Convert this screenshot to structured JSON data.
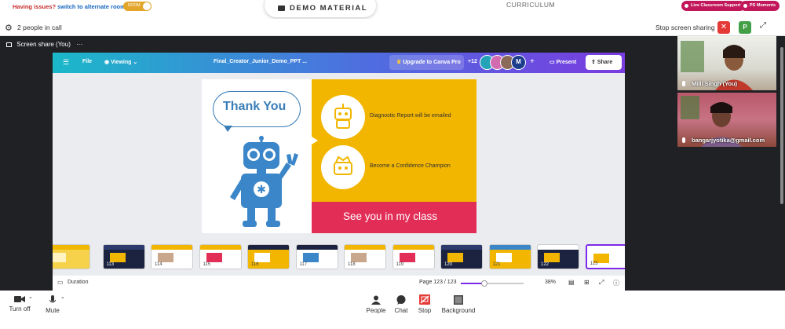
{
  "banner": {
    "issues_text": "Having issues?",
    "alternate_link": "switch to alternate room",
    "toggle_label": "ROOM",
    "demo_material": "DEMO MATERIAL",
    "curriculum": "CURRICULUM",
    "live_support": "Live Classroom Support",
    "ps_moments": "PS Moments"
  },
  "callbar": {
    "people_count": "2 people in call",
    "stop_sharing": "Stop screen sharing",
    "close_glyph": "✕",
    "p_badge": "P"
  },
  "share": {
    "label": "Screen share (You)",
    "more": "···"
  },
  "canva": {
    "file": "File",
    "viewing": "Viewing",
    "doc_title": "Final_Creator_Junior_Demo_PPT ...",
    "upgrade": "Upgrade to Canva Pro",
    "collab_count": "+12",
    "avatar_initial": "M",
    "plus": "+",
    "present": "Present",
    "share": "Share",
    "duration": "Duration",
    "page": "Page 123 / 123",
    "zoom": "38%",
    "zoom_fraction": 0.38
  },
  "slide": {
    "thank_you": "Thank You",
    "feature_1": "Diagnostic Report will be emailed",
    "feature_2": "Become a Confidence Champion",
    "cta": "See you in my class",
    "colors": {
      "yellow": "#f2b600",
      "pink": "#e22d57",
      "blue": "#3a7db8"
    }
  },
  "thumbnails": [
    {
      "num": "",
      "theme": "yellow-table"
    },
    {
      "num": "113",
      "theme": "dark"
    },
    {
      "num": "114",
      "theme": "white-photo"
    },
    {
      "num": "115",
      "theme": "white"
    },
    {
      "num": "116",
      "theme": "yellow"
    },
    {
      "num": "117",
      "theme": "white-dark"
    },
    {
      "num": "118",
      "theme": "white-photo"
    },
    {
      "num": "119",
      "theme": "white"
    },
    {
      "num": "120",
      "theme": "dark"
    },
    {
      "num": "121",
      "theme": "yellow-blue"
    },
    {
      "num": "122",
      "theme": "dark-list"
    },
    {
      "num": "123",
      "theme": "selected"
    }
  ],
  "participants": [
    {
      "name": "Milli Singh (You)"
    },
    {
      "name": "bangarjyotika@gmail.com"
    }
  ],
  "controls": {
    "turn_off": "Turn off",
    "mute": "Mute",
    "people": "People",
    "chat": "Chat",
    "stop": "Stop",
    "background": "Background"
  }
}
